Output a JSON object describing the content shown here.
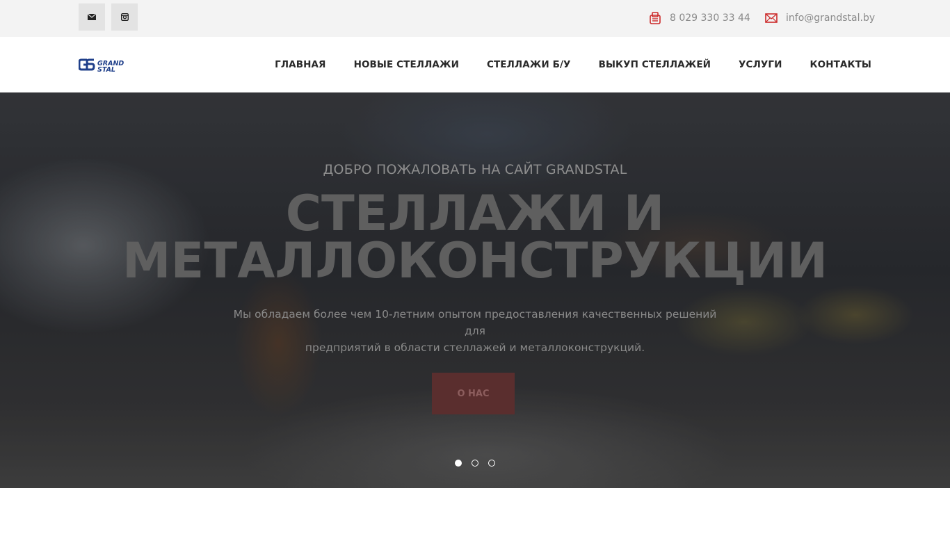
{
  "topbar": {
    "social": [
      {
        "icon": "mail-icon"
      },
      {
        "icon": "instagram-icon"
      }
    ],
    "phone": "8 029 330 33 44",
    "email": "info@grandstal.by"
  },
  "header": {
    "logo_text": "GRAND STAL",
    "nav": [
      "ГЛАВНАЯ",
      "НОВЫЕ СТЕЛЛАЖИ",
      "СТЕЛЛАЖИ Б/У",
      "ВЫКУП СТЕЛЛАЖЕЙ",
      "УСЛУГИ",
      "КОНТАКТЫ"
    ]
  },
  "hero": {
    "subtitle": "ДОБРО ПОЖАЛОВАТЬ НА САЙТ GRANDSTAL",
    "title_line1": "СТЕЛЛАЖИ И",
    "title_line2": "МЕТАЛЛОКОНСТРУКЦИИ",
    "description_line1": "Мы обладаем более чем 10-летним опытом предоставления качественных решений для",
    "description_line2": "предприятий в области стеллажей и металлоконструкций.",
    "button": "О НАС",
    "slides": 3,
    "active_slide": 1
  },
  "colors": {
    "topbar_bg": "#f3f3f3",
    "accent_red": "#cc2a2a",
    "logo_blue": "#1f3f8a"
  }
}
